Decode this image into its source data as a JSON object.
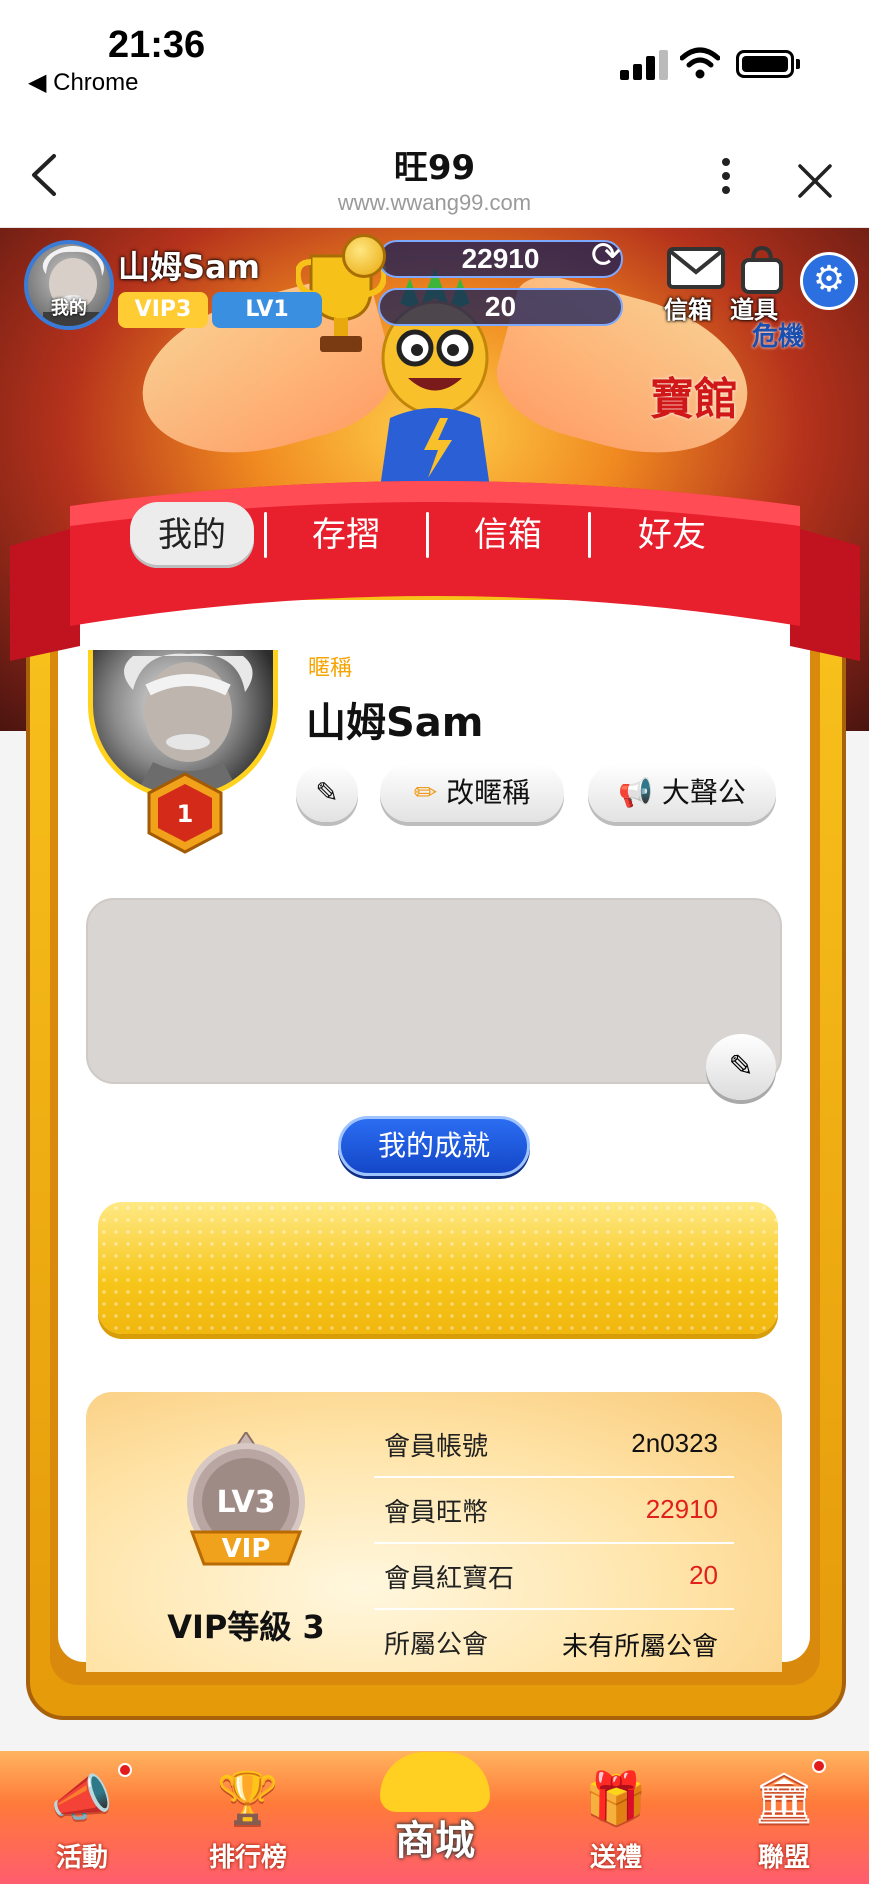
{
  "status_bar": {
    "time": "21:36",
    "back_app": "◀ Chrome"
  },
  "browser": {
    "title": "旺99",
    "url": "www.wwang99.com",
    "back_icon": "chevron-left-icon",
    "more_icon": "more-vertical-icon",
    "close_icon": "close-icon"
  },
  "game_header": {
    "avatar_label": "我的",
    "player_name": "山姆Sam",
    "vip_label": "VIP3",
    "level_label": "LV1",
    "coins": "22910",
    "gems": "20",
    "mailbox_label": "信箱",
    "items_label": "道具",
    "banner_text_1": "危機",
    "banner_text_2": "寶館"
  },
  "tabs": [
    {
      "label": "我的",
      "active": true
    },
    {
      "label": "存摺",
      "active": false
    },
    {
      "label": "信箱",
      "active": false
    },
    {
      "label": "好友",
      "active": false
    }
  ],
  "profile": {
    "nickname_label": "暱稱",
    "nickname": "山姆Sam",
    "level": "1",
    "rename_button": "改暱稱",
    "megaphone_button": "大聲公",
    "achievements_button": "我的成就"
  },
  "vip_panel": {
    "emblem_level": "LV3",
    "emblem_vip": "VIP",
    "level_text": "VIP等級 3",
    "rows": [
      {
        "label": "會員帳號",
        "value": "2n0323",
        "color": "#111111"
      },
      {
        "label": "會員旺幣",
        "value": "22910",
        "color": "#e0201c"
      },
      {
        "label": "會員紅寶石",
        "value": "20",
        "color": "#e0201c"
      },
      {
        "label": "所屬公會",
        "value": "未有所屬公會",
        "color": "#111111"
      }
    ]
  },
  "bottom_nav": [
    {
      "label": "活動",
      "icon": "megaphone-icon"
    },
    {
      "label": "排行榜",
      "icon": "trophy-icon"
    },
    {
      "label": "商城",
      "icon": "mall-icon"
    },
    {
      "label": "送禮",
      "icon": "gift-icon"
    },
    {
      "label": "聯盟",
      "icon": "bank-icon"
    }
  ],
  "colors": {
    "accent_red": "#e0201c",
    "gold": "#f7c61a",
    "blue_button": "#1f5be0"
  }
}
